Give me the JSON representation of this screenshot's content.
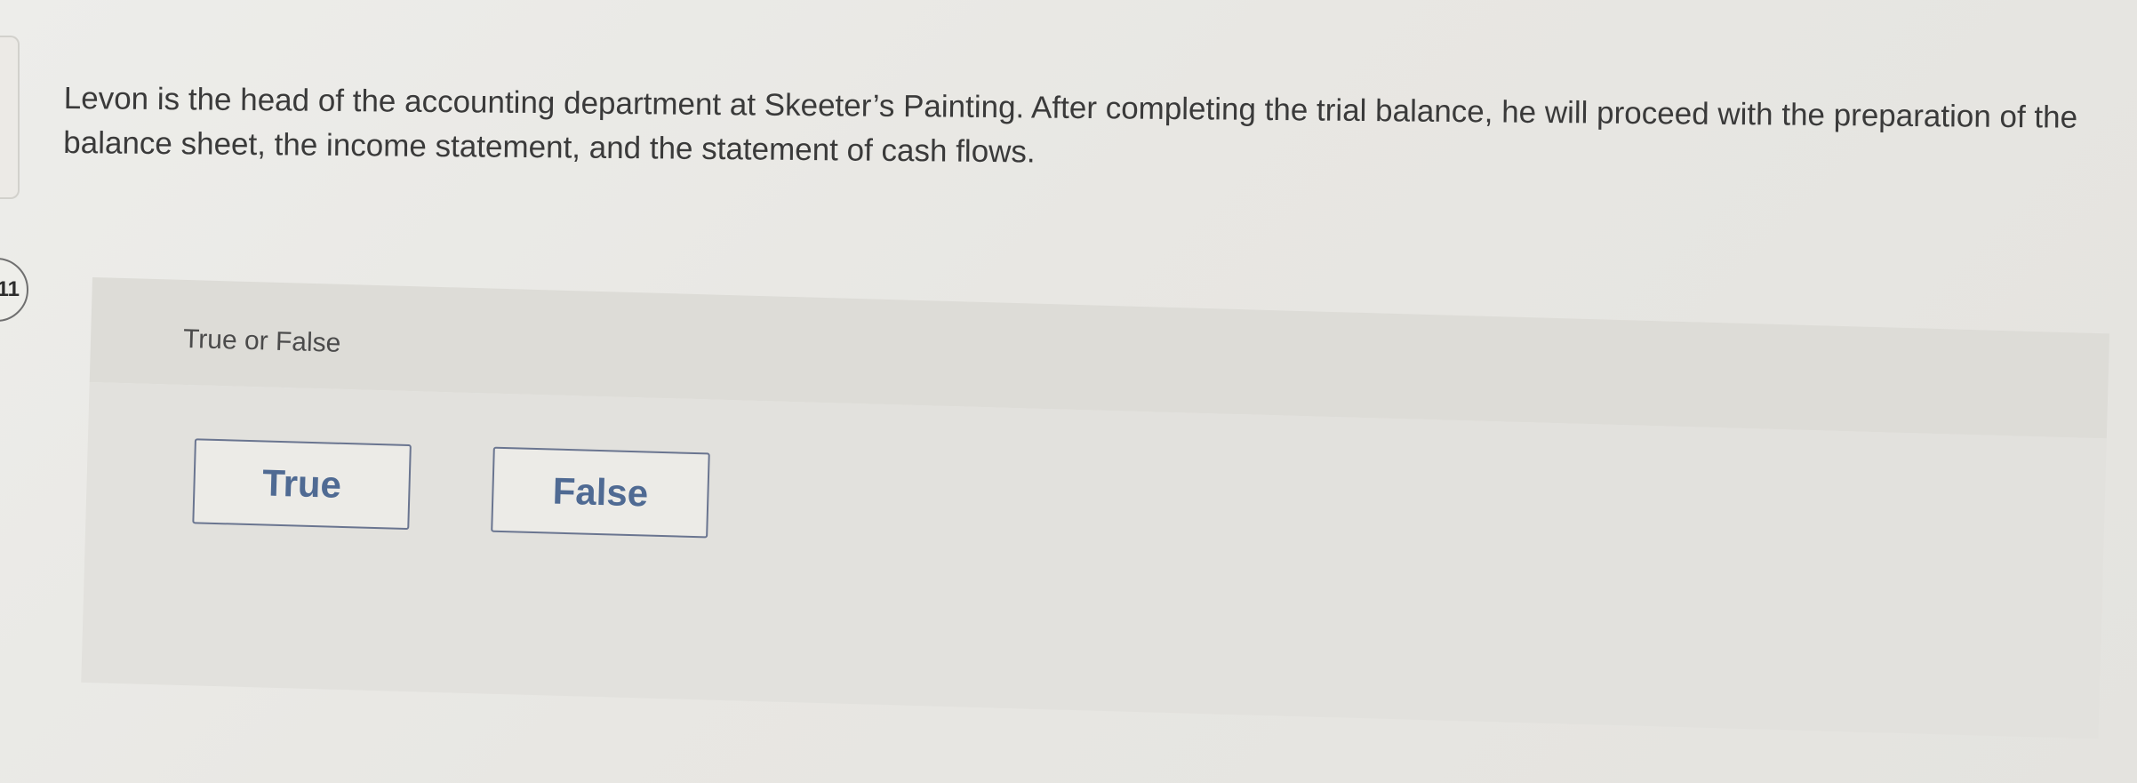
{
  "question": {
    "number": ":11",
    "text": "Levon is the head of the accounting department at Skeeter’s Painting. After completing the trial balance, he will proceed with the preparation of the balance sheet, the income statement, and the statement of cash flows."
  },
  "answer_panel": {
    "label": "True or False",
    "options": [
      {
        "label": "True"
      },
      {
        "label": "False"
      }
    ]
  },
  "colors": {
    "button_text": "#4f6a93",
    "button_border": "#6a7590",
    "panel_header": "#dddcd7",
    "panel_body": "#e2e1dd"
  }
}
